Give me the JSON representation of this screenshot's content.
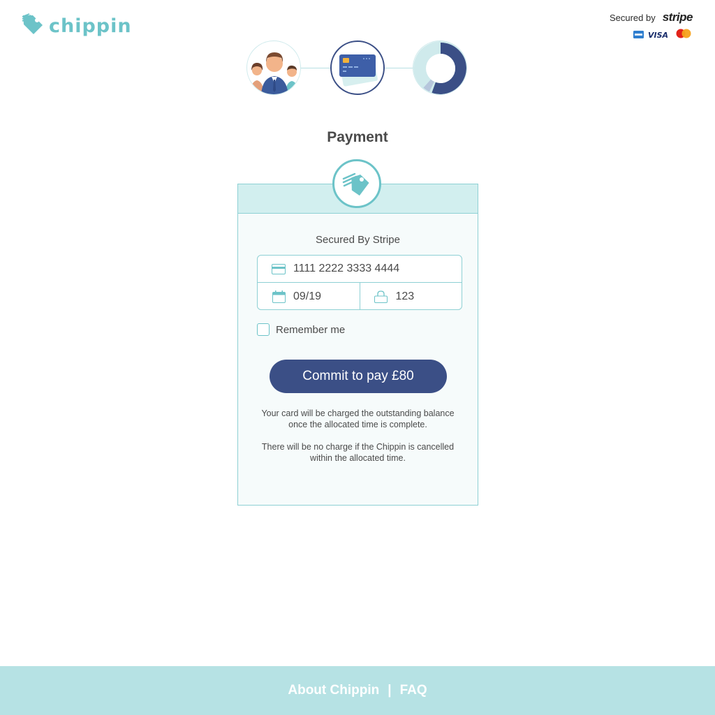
{
  "brand": {
    "name": "chippin",
    "color": "#6cc3c8"
  },
  "secured": {
    "label": "Secured by",
    "provider": "stripe",
    "card_icons": [
      "amex-icon",
      "visa-icon",
      "mastercard-icon"
    ]
  },
  "steps": [
    {
      "name": "group-step",
      "icon": "people-icon"
    },
    {
      "name": "payment-step",
      "icon": "credit-card-icon",
      "active": true
    },
    {
      "name": "progress-step",
      "icon": "donut-progress-icon"
    }
  ],
  "page": {
    "title": "Payment"
  },
  "form": {
    "subtitle": "Secured By Stripe",
    "card_number": "1111 2222 3333 4444",
    "expiry": "09/19",
    "cvc": "123",
    "remember_label": "Remember me",
    "pay_label": "Commit to pay £80",
    "note_1": "Your card will be charged the outstanding balance once the allocated time is complete.",
    "note_2": "There will be no charge if the Chippin is cancelled within the allocated time."
  },
  "footer": {
    "about": "About Chippin",
    "separator": "|",
    "faq": "FAQ"
  },
  "colors": {
    "primary": "#3b4f86",
    "accent": "#6cc3c8",
    "panel_head": "#d2efef",
    "footer": "#b6e2e4"
  }
}
